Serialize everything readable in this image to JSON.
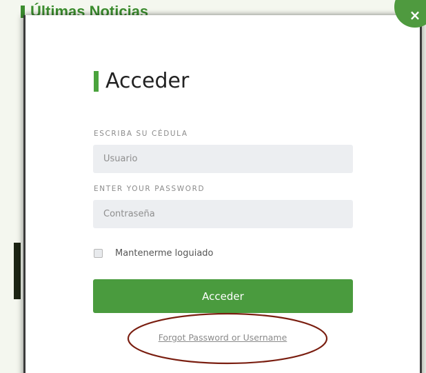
{
  "background": {
    "heading": "Últimas Noticias",
    "close_symbol": "×"
  },
  "login": {
    "title": "Acceder",
    "id_label": "ESCRIBA SU CÉDULA",
    "user_placeholder": "Usuario",
    "password_label": "ENTER YOUR PASSWORD",
    "password_placeholder": "Contraseña",
    "remember_label": "Mantenerme loguiado",
    "remember_checked": false,
    "submit_label": "Acceder",
    "forgot_link": "Forgot Password or Username"
  },
  "colors": {
    "accent_green": "#4a9b3e",
    "annotation_ellipse": "#7a1e10"
  },
  "icons": {
    "close": "close-icon"
  }
}
